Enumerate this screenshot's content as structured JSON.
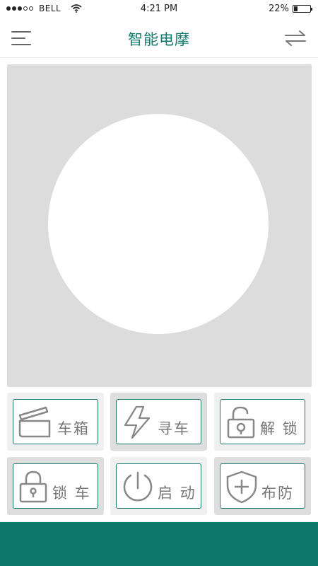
{
  "status_bar": {
    "carrier": "BELL",
    "time": "4:21 PM",
    "battery_percent": "22%",
    "battery_level": 0.22,
    "signal_bars_filled": 3,
    "signal_bars_total": 5
  },
  "header": {
    "title": "智能电摩",
    "menu_icon": "hamburger-menu-icon",
    "switch_icon": "swap-arrows-icon"
  },
  "colors": {
    "accent": "#0f7b6e",
    "bottom_bar": "#0d776b",
    "panel_bg": "#dcdcdc",
    "button_border": "#1a7a70"
  },
  "actions": [
    {
      "label": "车箱",
      "icon": "trunk-icon"
    },
    {
      "label": "寻车",
      "icon": "lightning-icon"
    },
    {
      "label": "解 锁",
      "icon": "unlock-icon"
    },
    {
      "label": "锁 车",
      "icon": "lock-icon"
    },
    {
      "label": "启 动",
      "icon": "power-icon"
    },
    {
      "label": "布防",
      "icon": "shield-plus-icon"
    }
  ]
}
